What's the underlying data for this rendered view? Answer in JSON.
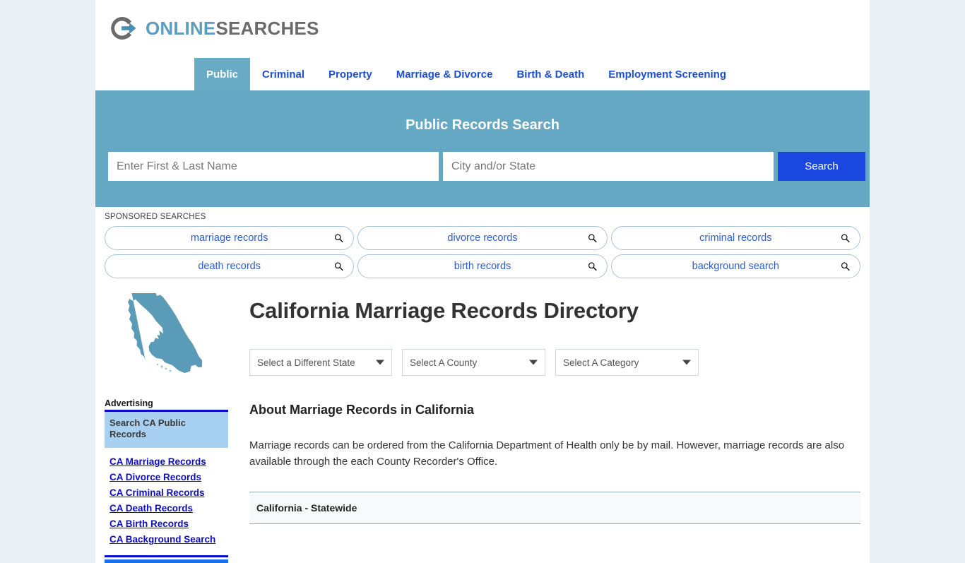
{
  "site": {
    "logo_primary": "ONLINE",
    "logo_secondary": "SEARCHES",
    "logo_icon": "circle-arrow-icon",
    "accent_blue": "#5b9ec1",
    "link_blue": "#1b4fd8",
    "banner_blue": "#64a8c4",
    "button_blue": "#1a47e0"
  },
  "nav": {
    "tabs": [
      {
        "label": "Public",
        "active": true
      },
      {
        "label": "Criminal",
        "active": false
      },
      {
        "label": "Property",
        "active": false
      },
      {
        "label": "Marriage & Divorce",
        "active": false
      },
      {
        "label": "Birth & Death",
        "active": false
      },
      {
        "label": "Employment Screening",
        "active": false
      }
    ]
  },
  "hero": {
    "title": "Public Records Search",
    "name_placeholder": "Enter First & Last Name",
    "name_value": "",
    "city_placeholder": "City and/or State",
    "city_value": "",
    "search_label": "Search"
  },
  "sponsored": {
    "label": "SPONSORED SEARCHES",
    "chips": [
      "marriage records",
      "divorce records",
      "criminal records",
      "death records",
      "birth records",
      "background search"
    ]
  },
  "sidebar": {
    "state_map_name": "california-state-map",
    "ad_label": "Advertising",
    "ad_title": "Search CA Public Records",
    "links": [
      "CA Marriage Records",
      "CA Divorce Records",
      "CA Criminal Records",
      "CA Death Records",
      "CA Birth Records",
      "CA Background Search"
    ]
  },
  "main": {
    "title": "California Marriage Records Directory",
    "selects": [
      {
        "label": "Select a Different State"
      },
      {
        "label": "Select A County"
      },
      {
        "label": "Select A Category"
      }
    ],
    "section_title": "About Marriage Records in California",
    "about_text": "Marriage records can be ordered from the California Department of Health only be by mail. However, marriage records are also available through the each County Recorder's Office.",
    "statewide_row": "California - Statewide"
  }
}
